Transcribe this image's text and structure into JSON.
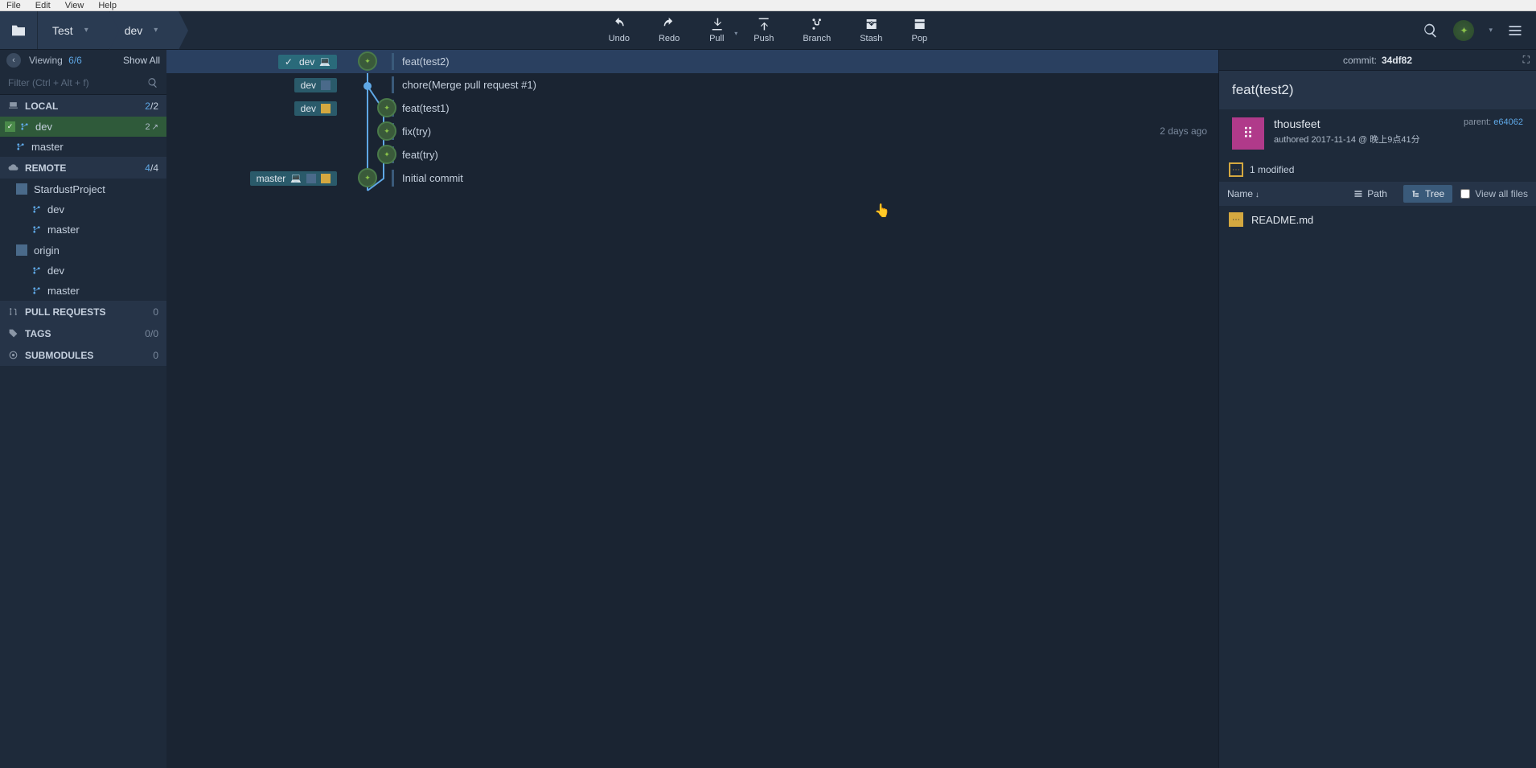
{
  "menu": {
    "file": "File",
    "edit": "Edit",
    "view": "View",
    "help": "Help"
  },
  "breadcrumb": {
    "repo": "Test",
    "branch": "dev"
  },
  "toolbar": {
    "undo": "Undo",
    "redo": "Redo",
    "pull": "Pull",
    "push": "Push",
    "branch": "Branch",
    "stash": "Stash",
    "pop": "Pop"
  },
  "sidebar": {
    "viewing_label": "Viewing",
    "viewing_count": "6",
    "viewing_total": "/6",
    "show_all": "Show All",
    "filter_placeholder": "Filter (Ctrl + Alt + f)",
    "local": {
      "title": "LOCAL",
      "count1": "2",
      "count2": "/2",
      "branches": [
        {
          "name": "dev",
          "badge": "2",
          "active": true
        },
        {
          "name": "master",
          "badge": "",
          "active": false
        }
      ]
    },
    "remote": {
      "title": "REMOTE",
      "count1": "4",
      "count2": "/4",
      "remotes": [
        {
          "name": "StardustProject",
          "branches": [
            "dev",
            "master"
          ]
        },
        {
          "name": "origin",
          "branches": [
            "dev",
            "master"
          ]
        }
      ]
    },
    "pull_requests": {
      "title": "PULL REQUESTS",
      "count": "0"
    },
    "tags": {
      "title": "TAGS",
      "count1": "0",
      "count2": "/0"
    },
    "submodules": {
      "title": "SUBMODULES",
      "count": "0"
    }
  },
  "commits": [
    {
      "tags": [
        {
          "name": "dev",
          "check": true,
          "laptop": true,
          "active": true
        }
      ],
      "msg": "feat(test2)",
      "time": "",
      "selected": true
    },
    {
      "tags": [
        {
          "name": "dev",
          "sq": true
        }
      ],
      "msg": "chore(Merge pull request #1)",
      "time": ""
    },
    {
      "tags": [
        {
          "name": "dev",
          "sq2": true
        }
      ],
      "msg": "feat(test1)",
      "time": ""
    },
    {
      "tags": [],
      "msg": "fix(try)",
      "time": "2 days ago"
    },
    {
      "tags": [],
      "msg": "feat(try)",
      "time": ""
    },
    {
      "tags": [
        {
          "name": "master",
          "sq": true,
          "sq2": true,
          "laptop": true
        }
      ],
      "msg": "Initial commit",
      "time": ""
    }
  ],
  "detail": {
    "commit_label": "commit:",
    "commit_hash": "34df82",
    "title": "feat(test2)",
    "author": "thousfeet",
    "authored_label": "authored",
    "date": "2017-11-14 @ 晚上9点41分",
    "parent_label": "parent:",
    "parent_hash": "e64062",
    "modified": "1 modified",
    "name_label": "Name",
    "path_label": "Path",
    "tree_label": "Tree",
    "view_all": "View all files",
    "files": [
      {
        "name": "README.md"
      }
    ]
  }
}
